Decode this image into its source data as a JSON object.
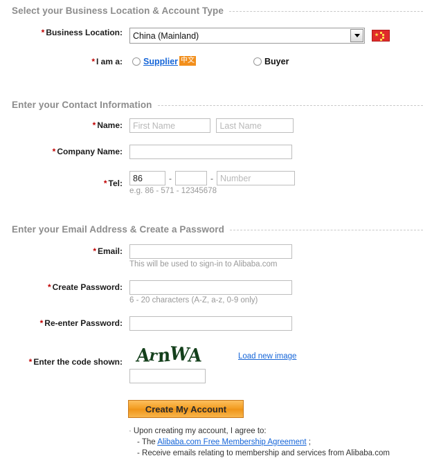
{
  "sections": {
    "location": {
      "title": "Select your Business Location & Account Type"
    },
    "contact": {
      "title": "Enter your Contact Information"
    },
    "account": {
      "title": "Enter your Email Address & Create a Password"
    }
  },
  "required_mark": "*",
  "business_location": {
    "label": "Business Location:",
    "selected": "China (Mainland)",
    "flag_icon": "china-flag-icon",
    "dropdown_icon": "chevron-down-icon"
  },
  "account_type": {
    "label": "I am a:",
    "supplier_label": "Supplier",
    "supplier_badge": "中文",
    "buyer_label": "Buyer"
  },
  "name": {
    "label": "Name:",
    "first_placeholder": "First Name",
    "first_value": "",
    "last_placeholder": "Last Name",
    "last_value": ""
  },
  "company": {
    "label": "Company Name:",
    "value": "",
    "placeholder": ""
  },
  "tel": {
    "label": "Tel:",
    "country_value": "86",
    "area_value": "",
    "number_placeholder": "Number",
    "number_value": "",
    "separator": "-",
    "hint": "e.g. 86  -   571   - 12345678"
  },
  "email": {
    "label": "Email:",
    "value": "",
    "placeholder": "",
    "hint": "This will be used to sign-in to Alibaba.com"
  },
  "password": {
    "label": "Create Password:",
    "value": "",
    "hint": "6 - 20 characters (A-Z, a-z, 0-9 only)"
  },
  "password_confirm": {
    "label": "Re-enter Password:",
    "value": ""
  },
  "captcha": {
    "label": "Enter the code shown:",
    "image_text": "ArnWA",
    "reload_link": "Load new image",
    "input_value": "",
    "input_placeholder": ""
  },
  "submit": {
    "label": "Create My Account"
  },
  "agreement": {
    "intro": "Upon creating my account, I agree to:",
    "line1_prefix": "- The ",
    "line1_link": "Alibaba.com Free Membership Agreement",
    "line1_suffix": " ;",
    "line2": "- Receive emails relating to membership and services from Alibaba.com"
  },
  "colors": {
    "accent_orange": "#f29d21",
    "link_blue": "#1565d8",
    "required_red": "#c00000",
    "header_gray": "#8c8c8c",
    "captcha_green": "#14401c",
    "flag_red": "#e02b2b"
  }
}
